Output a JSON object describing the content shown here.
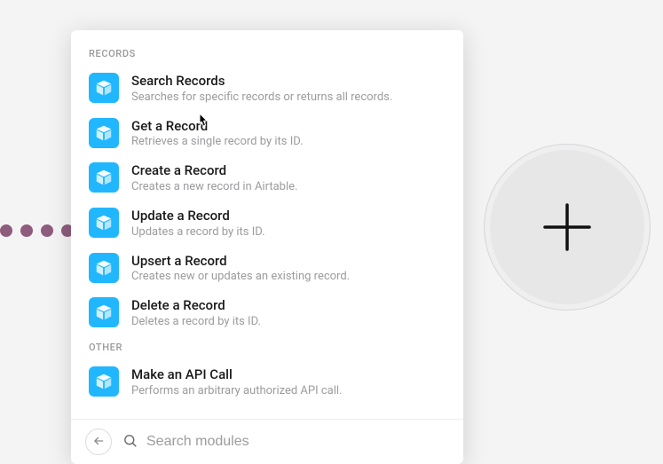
{
  "sections": {
    "records": {
      "header": "RECORDS",
      "items": [
        {
          "title": "Search Records",
          "desc": "Searches for specific records or returns all records."
        },
        {
          "title": "Get a Record",
          "desc": "Retrieves a single record by its ID."
        },
        {
          "title": "Create a Record",
          "desc": "Creates a new record in Airtable."
        },
        {
          "title": "Update a Record",
          "desc": "Updates a record by its ID."
        },
        {
          "title": "Upsert a Record",
          "desc": "Creates new or updates an existing record."
        },
        {
          "title": "Delete a Record",
          "desc": "Deletes a record by its ID."
        }
      ]
    },
    "other": {
      "header": "OTHER",
      "items": [
        {
          "title": "Make an API Call",
          "desc": "Performs an arbitrary authorized API call."
        }
      ]
    }
  },
  "search": {
    "placeholder": "Search modules"
  }
}
